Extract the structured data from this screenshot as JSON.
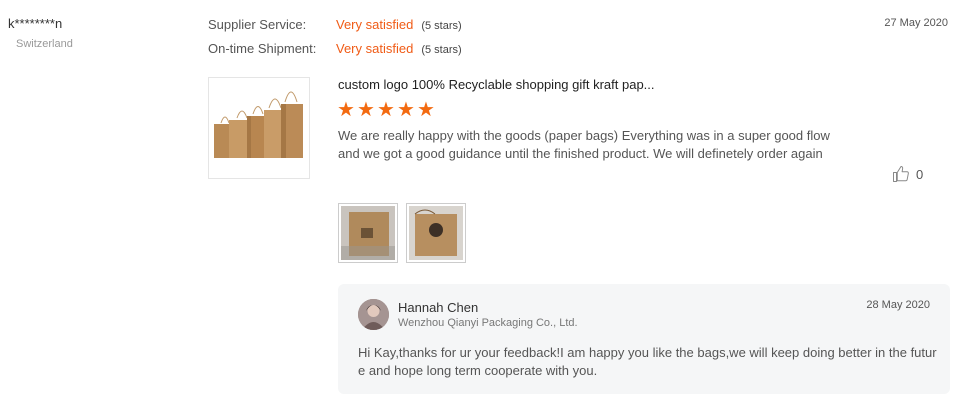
{
  "reviewer": {
    "name": "k********n",
    "country": "Switzerland"
  },
  "ratings": [
    {
      "label": "Supplier Service:",
      "value": "Very satisfied",
      "stars": "(5 stars)"
    },
    {
      "label": "On-time Shipment:",
      "value": "Very satisfied",
      "stars": "(5 stars)"
    }
  ],
  "review": {
    "date": "27 May 2020",
    "product_title": "custom logo 100% Recyclable shopping gift kraft pap...",
    "star_rating": 5,
    "star_icon": "star-icon",
    "text": "We are really happy with the goods (paper bags) Everything was in a super good flow and we got a good guidance until the finished product. We will definetely order again",
    "likes": "0",
    "like_icon": "thumbs-up-icon",
    "accent_color": "#f05b16"
  },
  "reply": {
    "name": "Hannah Chen",
    "company": "Wenzhou Qianyi Packaging Co., Ltd.",
    "date": "28 May 2020",
    "text": "Hi Kay,thanks for ur your feedback!I am happy you like the bags,we will keep doing better in the future and hope long term cooperate with you."
  }
}
